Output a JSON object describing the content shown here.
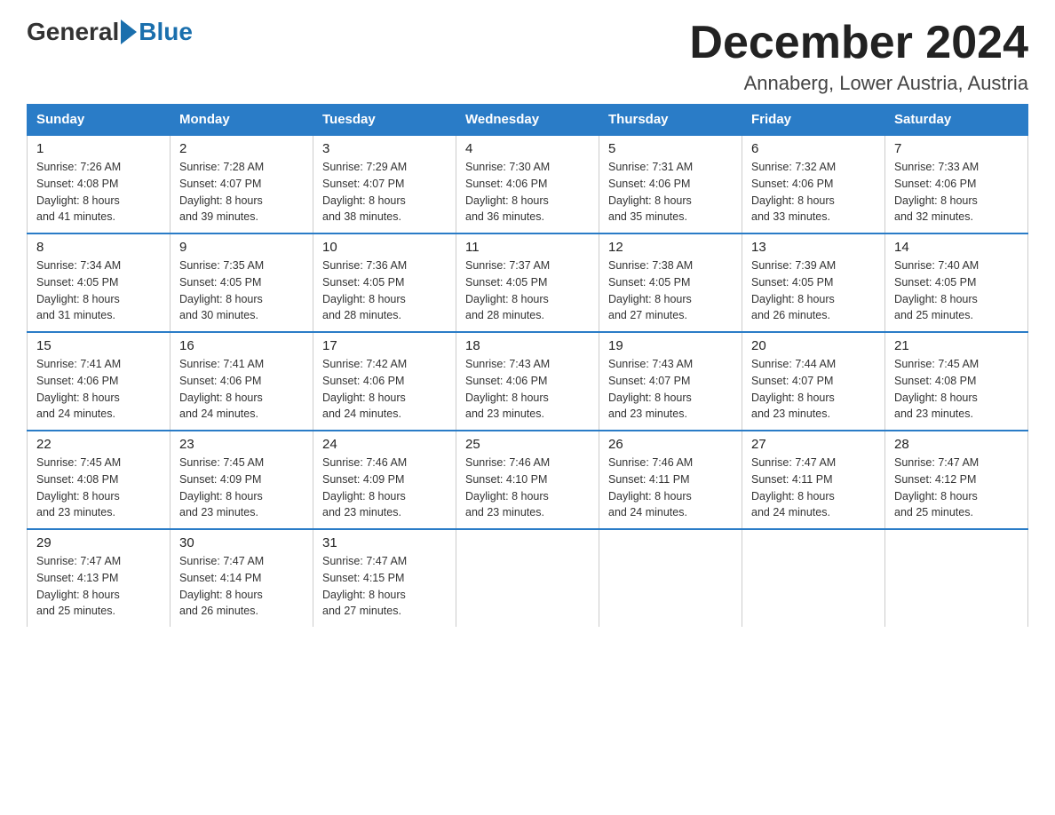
{
  "header": {
    "logo_general": "General",
    "logo_blue": "Blue",
    "month_title": "December 2024",
    "subtitle": "Annaberg, Lower Austria, Austria"
  },
  "weekdays": [
    "Sunday",
    "Monday",
    "Tuesday",
    "Wednesday",
    "Thursday",
    "Friday",
    "Saturday"
  ],
  "weeks": [
    [
      {
        "day": "1",
        "sunrise": "7:26 AM",
        "sunset": "4:08 PM",
        "daylight": "8 hours and 41 minutes."
      },
      {
        "day": "2",
        "sunrise": "7:28 AM",
        "sunset": "4:07 PM",
        "daylight": "8 hours and 39 minutes."
      },
      {
        "day": "3",
        "sunrise": "7:29 AM",
        "sunset": "4:07 PM",
        "daylight": "8 hours and 38 minutes."
      },
      {
        "day": "4",
        "sunrise": "7:30 AM",
        "sunset": "4:06 PM",
        "daylight": "8 hours and 36 minutes."
      },
      {
        "day": "5",
        "sunrise": "7:31 AM",
        "sunset": "4:06 PM",
        "daylight": "8 hours and 35 minutes."
      },
      {
        "day": "6",
        "sunrise": "7:32 AM",
        "sunset": "4:06 PM",
        "daylight": "8 hours and 33 minutes."
      },
      {
        "day": "7",
        "sunrise": "7:33 AM",
        "sunset": "4:06 PM",
        "daylight": "8 hours and 32 minutes."
      }
    ],
    [
      {
        "day": "8",
        "sunrise": "7:34 AM",
        "sunset": "4:05 PM",
        "daylight": "8 hours and 31 minutes."
      },
      {
        "day": "9",
        "sunrise": "7:35 AM",
        "sunset": "4:05 PM",
        "daylight": "8 hours and 30 minutes."
      },
      {
        "day": "10",
        "sunrise": "7:36 AM",
        "sunset": "4:05 PM",
        "daylight": "8 hours and 28 minutes."
      },
      {
        "day": "11",
        "sunrise": "7:37 AM",
        "sunset": "4:05 PM",
        "daylight": "8 hours and 28 minutes."
      },
      {
        "day": "12",
        "sunrise": "7:38 AM",
        "sunset": "4:05 PM",
        "daylight": "8 hours and 27 minutes."
      },
      {
        "day": "13",
        "sunrise": "7:39 AM",
        "sunset": "4:05 PM",
        "daylight": "8 hours and 26 minutes."
      },
      {
        "day": "14",
        "sunrise": "7:40 AM",
        "sunset": "4:05 PM",
        "daylight": "8 hours and 25 minutes."
      }
    ],
    [
      {
        "day": "15",
        "sunrise": "7:41 AM",
        "sunset": "4:06 PM",
        "daylight": "8 hours and 24 minutes."
      },
      {
        "day": "16",
        "sunrise": "7:41 AM",
        "sunset": "4:06 PM",
        "daylight": "8 hours and 24 minutes."
      },
      {
        "day": "17",
        "sunrise": "7:42 AM",
        "sunset": "4:06 PM",
        "daylight": "8 hours and 24 minutes."
      },
      {
        "day": "18",
        "sunrise": "7:43 AM",
        "sunset": "4:06 PM",
        "daylight": "8 hours and 23 minutes."
      },
      {
        "day": "19",
        "sunrise": "7:43 AM",
        "sunset": "4:07 PM",
        "daylight": "8 hours and 23 minutes."
      },
      {
        "day": "20",
        "sunrise": "7:44 AM",
        "sunset": "4:07 PM",
        "daylight": "8 hours and 23 minutes."
      },
      {
        "day": "21",
        "sunrise": "7:45 AM",
        "sunset": "4:08 PM",
        "daylight": "8 hours and 23 minutes."
      }
    ],
    [
      {
        "day": "22",
        "sunrise": "7:45 AM",
        "sunset": "4:08 PM",
        "daylight": "8 hours and 23 minutes."
      },
      {
        "day": "23",
        "sunrise": "7:45 AM",
        "sunset": "4:09 PM",
        "daylight": "8 hours and 23 minutes."
      },
      {
        "day": "24",
        "sunrise": "7:46 AM",
        "sunset": "4:09 PM",
        "daylight": "8 hours and 23 minutes."
      },
      {
        "day": "25",
        "sunrise": "7:46 AM",
        "sunset": "4:10 PM",
        "daylight": "8 hours and 23 minutes."
      },
      {
        "day": "26",
        "sunrise": "7:46 AM",
        "sunset": "4:11 PM",
        "daylight": "8 hours and 24 minutes."
      },
      {
        "day": "27",
        "sunrise": "7:47 AM",
        "sunset": "4:11 PM",
        "daylight": "8 hours and 24 minutes."
      },
      {
        "day": "28",
        "sunrise": "7:47 AM",
        "sunset": "4:12 PM",
        "daylight": "8 hours and 25 minutes."
      }
    ],
    [
      {
        "day": "29",
        "sunrise": "7:47 AM",
        "sunset": "4:13 PM",
        "daylight": "8 hours and 25 minutes."
      },
      {
        "day": "30",
        "sunrise": "7:47 AM",
        "sunset": "4:14 PM",
        "daylight": "8 hours and 26 minutes."
      },
      {
        "day": "31",
        "sunrise": "7:47 AM",
        "sunset": "4:15 PM",
        "daylight": "8 hours and 27 minutes."
      },
      null,
      null,
      null,
      null
    ]
  ],
  "labels": {
    "sunrise_prefix": "Sunrise: ",
    "sunset_prefix": "Sunset: ",
    "daylight_prefix": "Daylight: "
  }
}
